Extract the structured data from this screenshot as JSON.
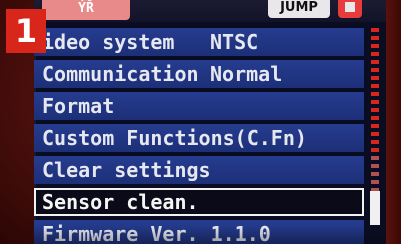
{
  "badge": {
    "number": "1"
  },
  "header": {
    "active_tab_label": "ÝŘ",
    "jump_label": "JUMP",
    "settings_tab_icon": "wrench-icon"
  },
  "menu": {
    "items": [
      {
        "label": "ideo system",
        "value": "NTSC",
        "selected": false
      },
      {
        "label": "Communication",
        "value": "Normal",
        "selected": false
      },
      {
        "label": "Format",
        "value": "",
        "selected": false
      },
      {
        "label": "Custom Functions(C.Fn)",
        "value": "",
        "selected": false
      },
      {
        "label": "Clear settings",
        "value": "",
        "selected": false
      },
      {
        "label": "Sensor clean.",
        "value": "",
        "selected": true
      },
      {
        "label": "Firmware Ver. 1.1.0",
        "value": "",
        "selected": false
      }
    ]
  },
  "colors": {
    "menu_row": "#263c8f",
    "selected_row": "#0a0a18",
    "scroll_red": "#d9261b",
    "scroll_white": "#f0f0f0",
    "badge": "#d9261b",
    "jump_button": "#e9e7ea",
    "active_tab": "#e98a8a"
  },
  "scroll": {
    "position_fraction": 0.9
  }
}
